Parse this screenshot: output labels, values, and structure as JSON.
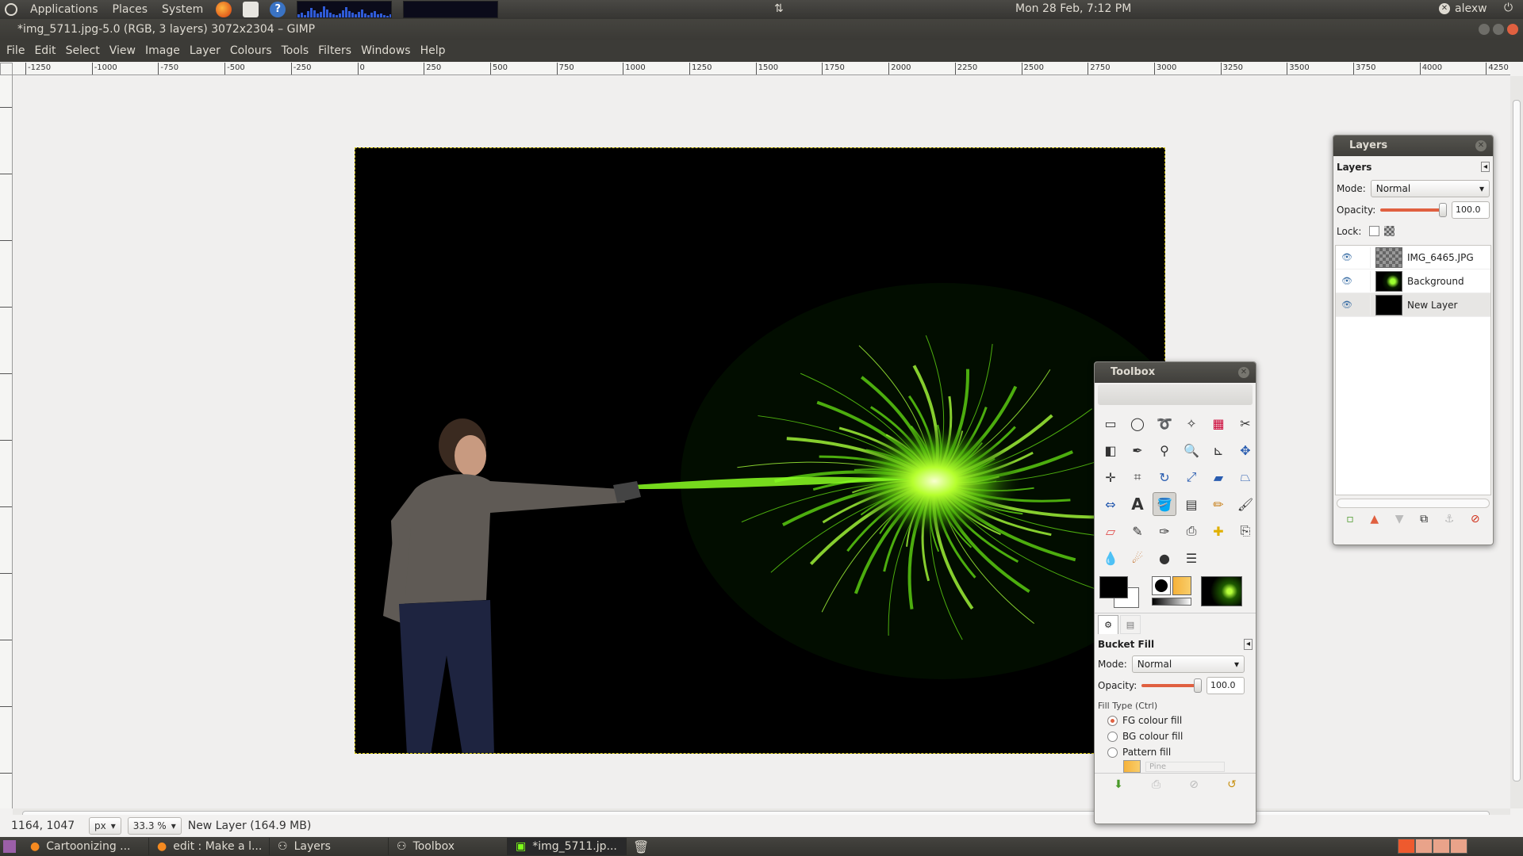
{
  "top_panel": {
    "menus": [
      "Applications",
      "Places",
      "System"
    ],
    "clock": "Mon 28 Feb,  7:12 PM",
    "user": "alexw"
  },
  "window": {
    "title": "*img_5711.jpg-5.0 (RGB, 3 layers) 3072x2304 – GIMP",
    "menu": [
      "File",
      "Edit",
      "Select",
      "View",
      "Image",
      "Layer",
      "Colours",
      "Tools",
      "Filters",
      "Windows",
      "Help"
    ]
  },
  "ruler": {
    "top_ticks": [
      "-1250",
      "-1000",
      "-750",
      "-500",
      "-250",
      "0",
      "250",
      "500",
      "750",
      "1000",
      "1250",
      "1500",
      "1750",
      "2000",
      "2250",
      "2500",
      "2750",
      "3000",
      "3250",
      "3500",
      "3750",
      "4000",
      "4250"
    ]
  },
  "statusbar": {
    "coords": "1164, 1047",
    "unit": "px",
    "zoom": "33.3 %",
    "message": "New Layer (164.9 MB)"
  },
  "layers_dock": {
    "title": "Layers",
    "tab_label": "Layers",
    "mode_label": "Mode:",
    "mode_value": "Normal",
    "opacity_label": "Opacity:",
    "opacity_value": "100.0",
    "lock_label": "Lock:",
    "layers": [
      {
        "name": "IMG_6465.JPG"
      },
      {
        "name": "Background"
      },
      {
        "name": "New Layer"
      }
    ]
  },
  "toolbox": {
    "title": "Toolbox",
    "options_title": "Bucket Fill",
    "mode_label": "Mode:",
    "mode_value": "Normal",
    "opacity_label": "Opacity:",
    "opacity_value": "100.0",
    "fill_type_label": "Fill Type  (Ctrl)",
    "fill_options": [
      "FG colour fill",
      "BG colour fill",
      "Pattern fill"
    ],
    "pattern_name": "Pine"
  },
  "taskbar": {
    "tasks": [
      "Cartoonizing ...",
      "edit : Make a l...",
      "Layers",
      "Toolbox",
      "*img_5711.jp..."
    ]
  },
  "colors": {
    "accent": "#e06040",
    "fg_colour": "#000000",
    "bg_colour": "#ffffff",
    "glow": "#7dff1a"
  }
}
